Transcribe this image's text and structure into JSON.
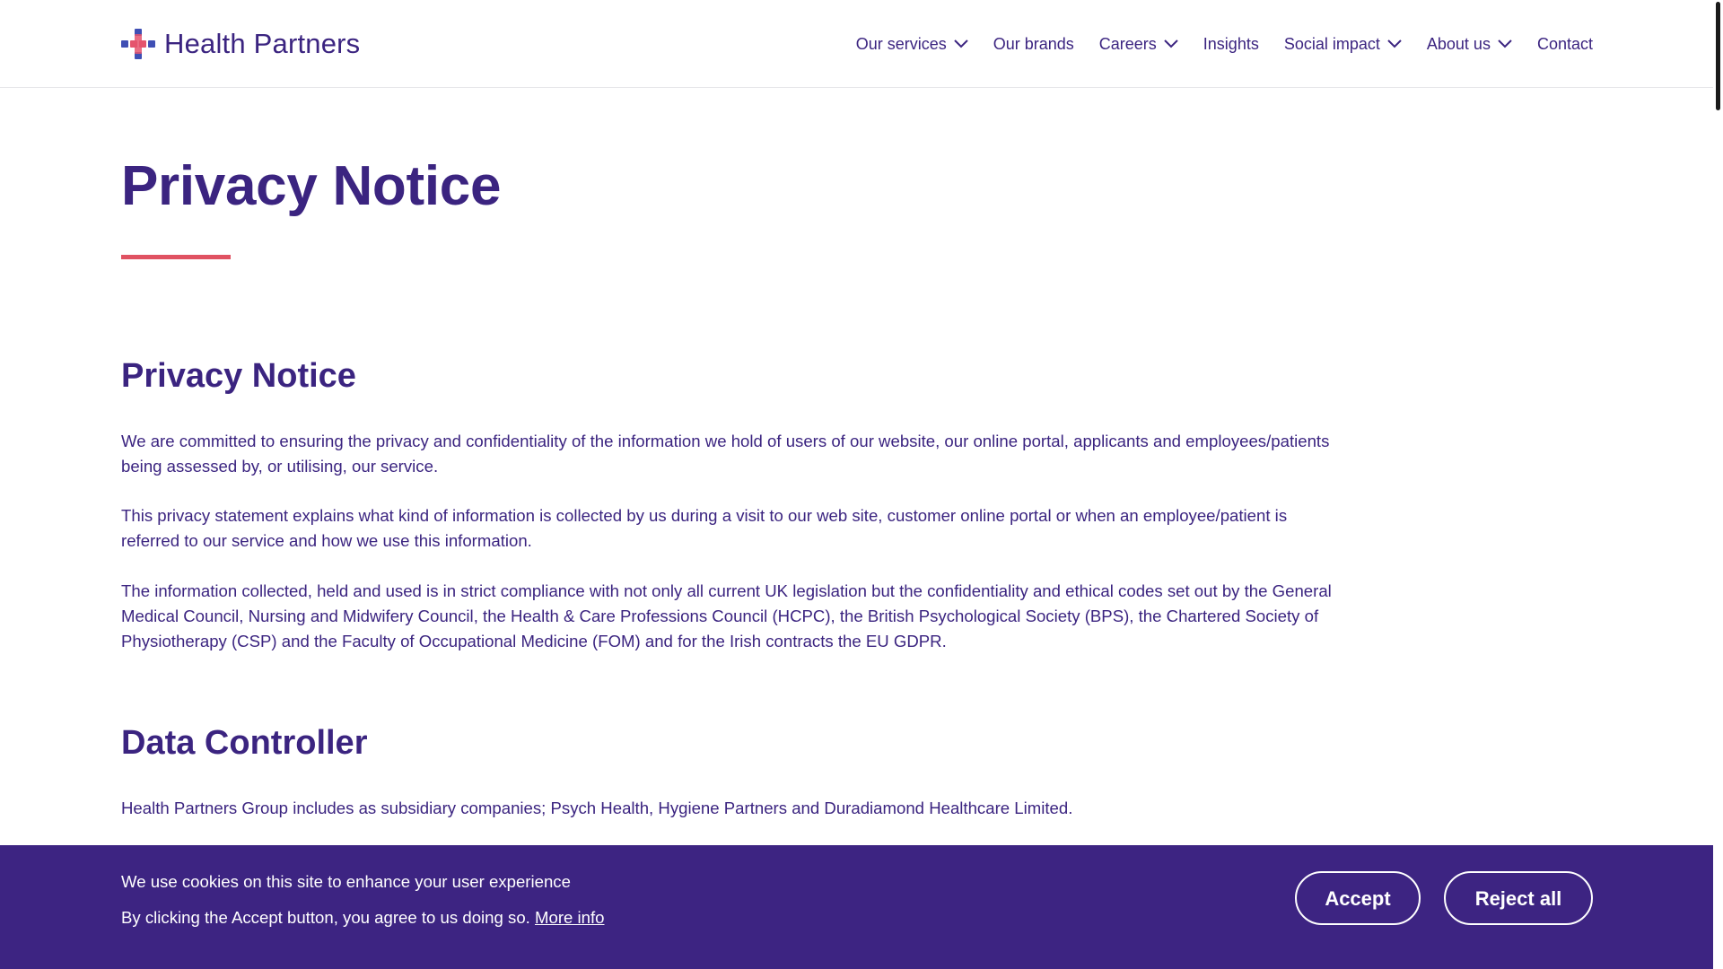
{
  "header": {
    "logo_text": "Health Partners",
    "nav": [
      {
        "label": "Our services",
        "has_dropdown": true
      },
      {
        "label": "Our brands",
        "has_dropdown": false
      },
      {
        "label": "Careers",
        "has_dropdown": true
      },
      {
        "label": "Insights",
        "has_dropdown": false
      },
      {
        "label": "Social impact",
        "has_dropdown": true
      },
      {
        "label": "About us",
        "has_dropdown": true
      },
      {
        "label": "Contact",
        "has_dropdown": false
      }
    ]
  },
  "main": {
    "page_title": "Privacy Notice",
    "sections": [
      {
        "heading": "Privacy Notice",
        "paragraphs": [
          "We are committed to ensuring the privacy and confidentiality of the information we hold of users of our website, our online portal, applicants and employees/patients being assessed by, or utilising, our service.",
          "This privacy statement explains what kind of information is collected by us during a visit to our web site, customer online portal or when an employee/patient is referred to our service and how we use this information.",
          "The information collected, held and used is in strict compliance with not only all current UK legislation but the confidentiality and ethical codes set out by the General Medical Council, Nursing and Midwifery Council, the Health & Care Professions Council (HCPC), the British Psychological Society (BPS), the Chartered Society of Physiotherapy (CSP) and the Faculty of Occupational Medicine (FOM) and for the Irish contracts the EU GDPR."
        ]
      },
      {
        "heading": "Data Controller",
        "paragraphs": [
          "Health Partners Group includes as subsidiary companies; Psych Health, Hygiene Partners and Duradiamond Healthcare Limited."
        ]
      }
    ]
  },
  "cookie_banner": {
    "line1": "We use cookies on this site to enhance your user experience",
    "line2": "By clicking the Accept button, you agree to us doing so.",
    "more_info": "More info",
    "accept_label": "Accept",
    "reject_label": "Reject all"
  },
  "colors": {
    "brand_purple": "#3b2480",
    "accent_red": "#e05262",
    "banner_bg": "#3d2482",
    "logo_blue": "#3f4fb4",
    "logo_pink": "#e5546d"
  }
}
